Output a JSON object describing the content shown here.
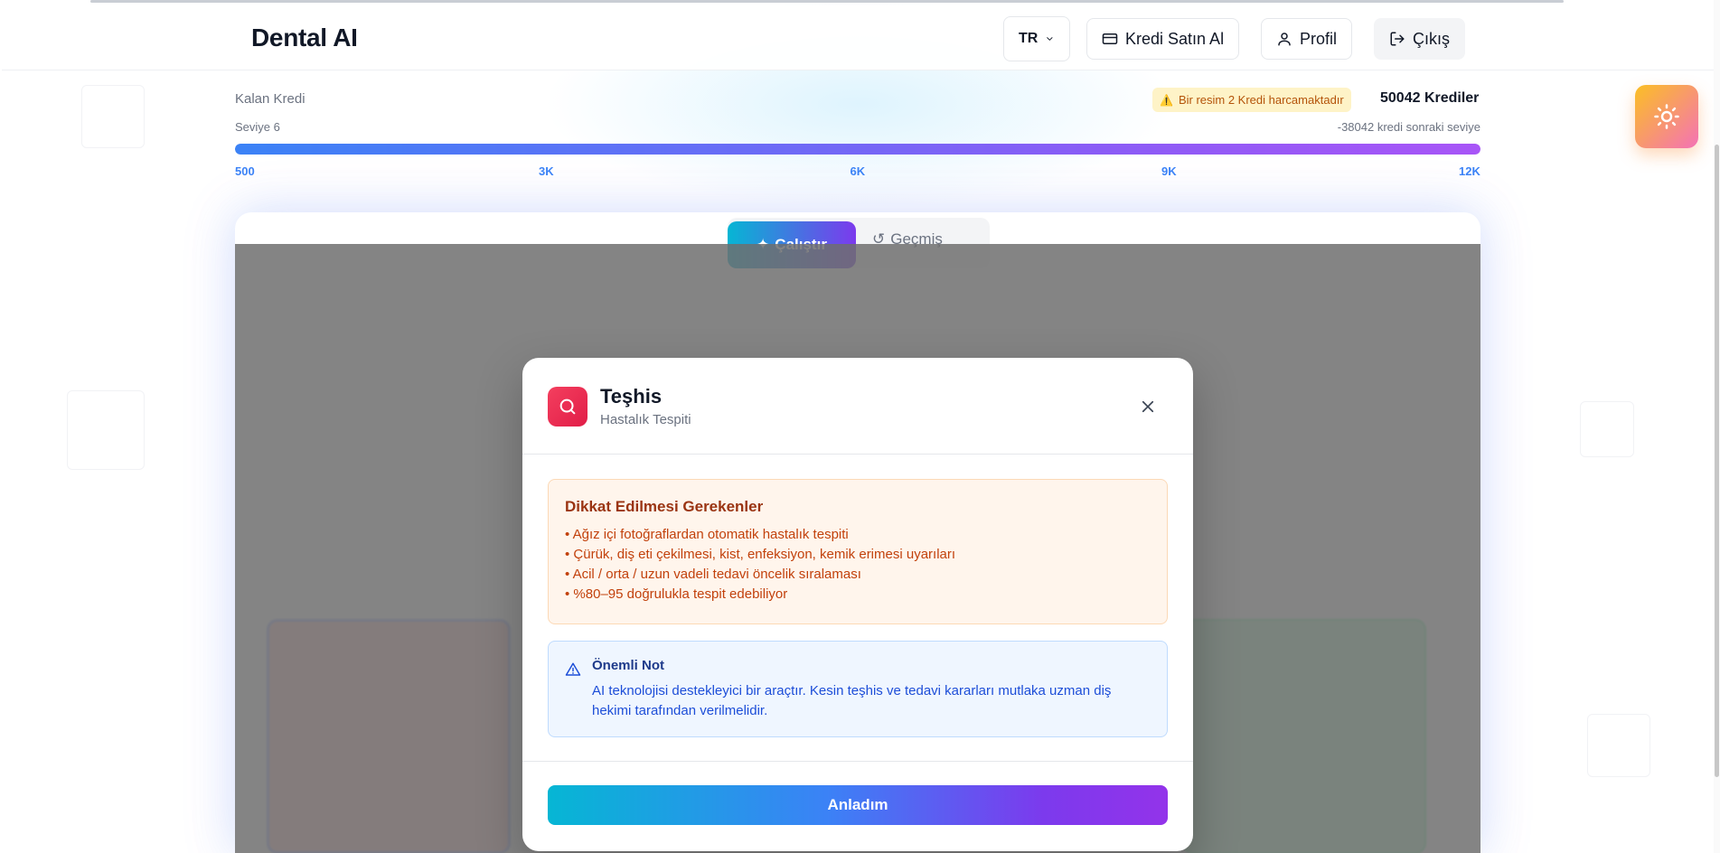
{
  "header": {
    "brand": "Dental AI",
    "lang": "TR",
    "buy_credits": "Kredi Satın Al",
    "profile": "Profil",
    "logout": "Çıkış"
  },
  "credits": {
    "label": "Kalan Kredi",
    "level": "Seviye 6",
    "warning": "Bir resim 2 Kredi harcamaktadır",
    "value": "50042 Krediler",
    "next_level": "-38042 kredi sonraki seviye",
    "progress": 1.0,
    "ticks": [
      "500",
      "3K",
      "6K",
      "9K",
      "12K"
    ]
  },
  "tabs": {
    "run": "Çalıştır",
    "history": "Geçmiş"
  },
  "modal": {
    "title": "Teşhis",
    "subtitle": "Hastalık Tespiti",
    "attention": {
      "title": "Dikkat Edilmesi Gerekenler",
      "items": [
        "• Ağız içi fotoğraflardan otomatik hastalık tespiti",
        "• Çürük, diş eti çekilmesi, kist, enfeksiyon, kemik erimesi uyarıları",
        "• Acil / orta / uzun vadeli tedavi öncelik sıralaması",
        "• %80–95 doğrulukla tespit edebiliyor"
      ]
    },
    "note": {
      "title": "Önemli Not",
      "text": "AI teknolojisi destekleyici bir araçtır. Kesin teşhis ve tedavi kararları mutlaka uzman diş hekimi tarafından verilmelidir."
    },
    "confirm": "Anladım"
  },
  "colors": {
    "accent_start": "#06b6d4",
    "accent_end": "#9333ea",
    "warning_bg": "#fff5ec",
    "note_bg": "#eff6ff"
  }
}
